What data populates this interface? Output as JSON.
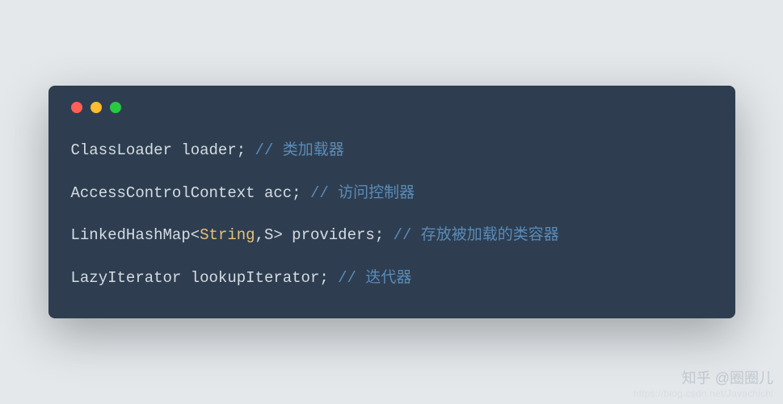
{
  "window": {
    "colors": {
      "bg": "#e4e8eb",
      "panel": "#2e3e50",
      "red": "#ff5f57",
      "yellow": "#febc2e",
      "green": "#28c840",
      "code": "#d5dce3",
      "type": "#e7c07a",
      "comment": "#5a8bb8"
    }
  },
  "lines": [
    {
      "code1": "ClassLoader loader;  ",
      "comment": "// 类加载器"
    },
    {
      "code1": "AccessControlContext acc; ",
      "comment": "// 访问控制器"
    },
    {
      "code1": "LinkedHashMap<",
      "type": "String",
      "code2": ",S> providers;   ",
      "comment": "// 存放被加载的类容器"
    },
    {
      "code1": "LazyIterator lookupIterator;   ",
      "comment": "// 迭代器"
    }
  ],
  "watermark": {
    "brand": "知乎 @圈圈儿",
    "url": "https://blog.csdn.net/Javachichi"
  }
}
